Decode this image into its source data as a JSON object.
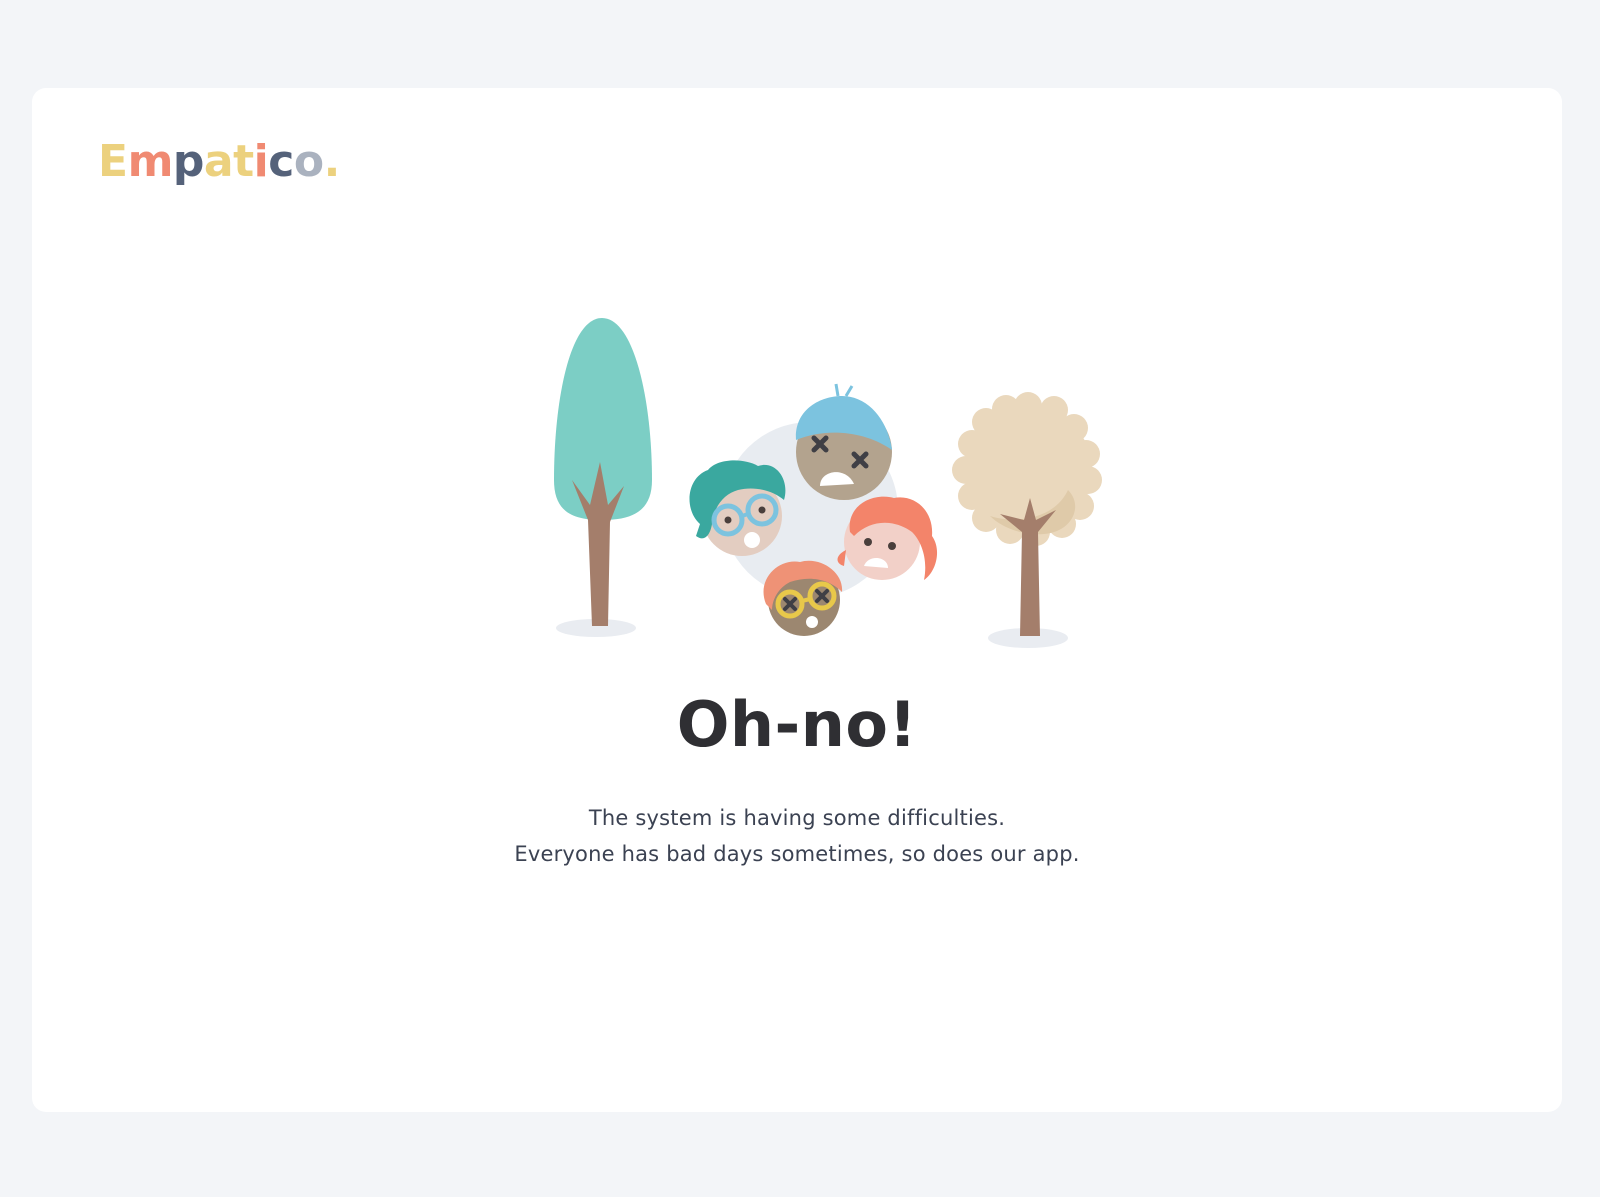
{
  "brand": {
    "logo_letters": [
      "E",
      "m",
      "p",
      "a",
      "t",
      "i",
      "c",
      "o",
      "."
    ],
    "logo_colors": [
      "#ecd17e",
      "#f08a72",
      "#55627a",
      "#ecd17e",
      "#ecd17e",
      "#f08a72",
      "#55627a",
      "#aab2bf",
      "#ecd17e"
    ]
  },
  "error": {
    "title": "Oh-no!",
    "line1": "The system is having some difficulties.",
    "line2": "Everyone has bad days sometimes, so does our app."
  },
  "illustration": {
    "icons": [
      "tall-tree-icon",
      "round-tree-icon",
      "sad-faces-icon"
    ]
  }
}
